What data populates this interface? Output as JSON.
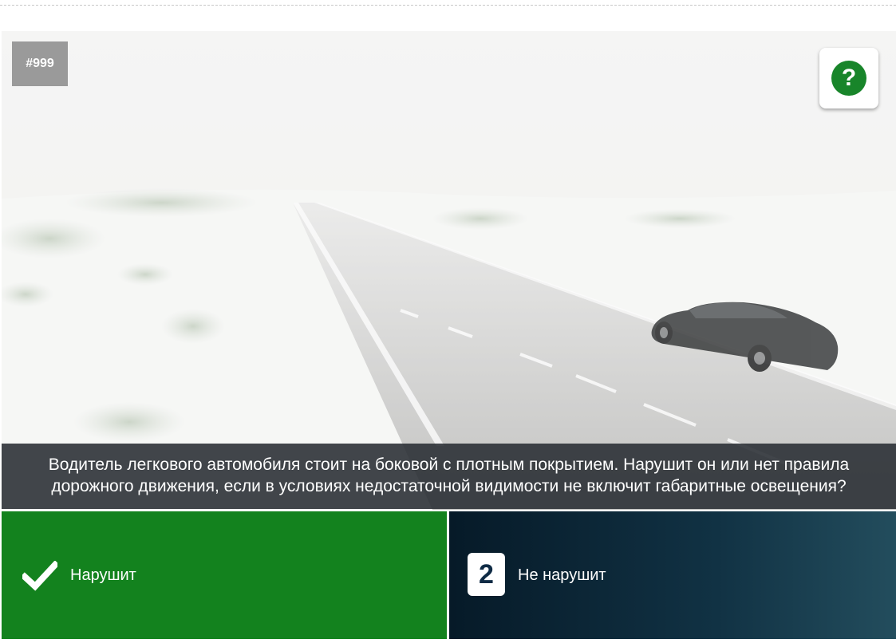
{
  "question": {
    "id_badge": "#999",
    "text_line1": "Водитель легкового автомобиля стоит на боковой с плотным покрытием. Нарушит он или нет правила",
    "text_line2": "дорожного движения, если в условиях недостаточной видимости не включит габаритные освещения?",
    "hint_icon": "question-mark-icon",
    "hint_symbol": "?"
  },
  "answers": [
    {
      "label": "Нарушит",
      "icon": "checkmark-icon",
      "state": "correct"
    },
    {
      "label": "Не нарушит",
      "icon": "number-badge",
      "number": "2"
    }
  ],
  "colors": {
    "correct_green": "#13821e",
    "hint_green": "#18852a",
    "dark_answer": "#113244",
    "question_overlay": "#282c32",
    "id_badge_bg": "#9a9a9a"
  }
}
